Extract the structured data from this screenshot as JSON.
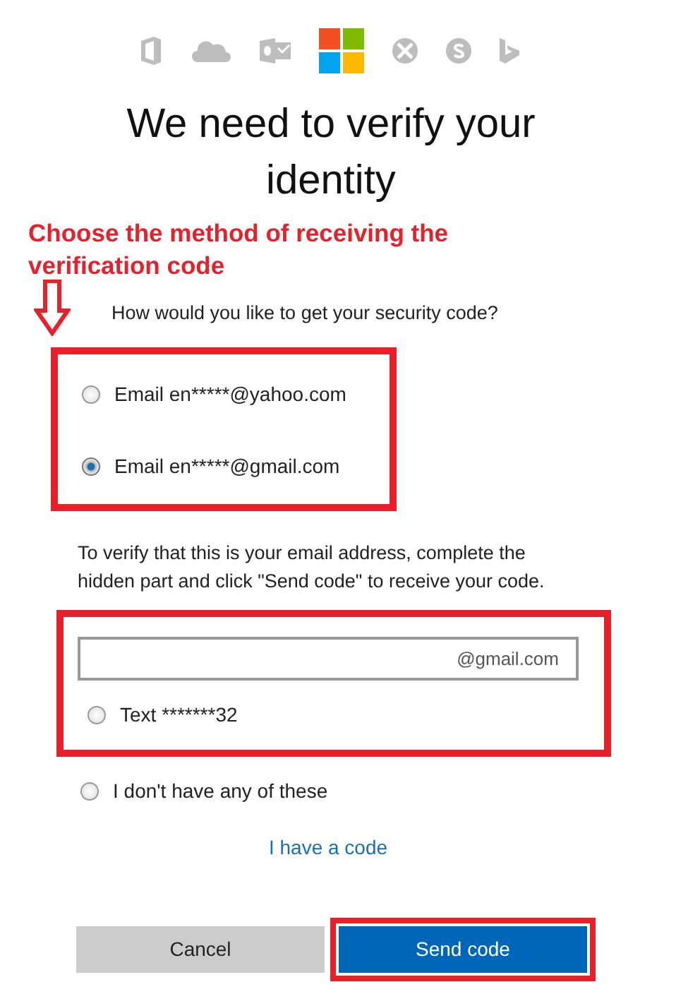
{
  "title": "We need to verify your identity",
  "annotation": {
    "text": "Choose the method of receiving the verification code"
  },
  "question": "How would you like to get your security code?",
  "options": [
    {
      "kind": "radio",
      "label": "Email en*****@yahoo.com",
      "selected": false,
      "framed": true
    },
    {
      "kind": "radio",
      "label": "Email en*****@gmail.com",
      "selected": true,
      "framed": true
    },
    {
      "kind": "hint",
      "text": "To verify that this is your email address, complete the hidden part and click \"Send code\" to receive your code."
    },
    {
      "kind": "field",
      "suffix": "@gmail.com",
      "framed": true
    },
    {
      "kind": "radio",
      "label": "Text *******32",
      "selected": false,
      "framed": true
    },
    {
      "kind": "radio",
      "label": "I don't have any of these",
      "selected": false,
      "framed": false
    }
  ],
  "link": "I have a code",
  "buttons": [
    {
      "label": "Cancel",
      "kind": "secondary",
      "framed": false
    },
    {
      "label": "Send code",
      "kind": "primary",
      "framed": true
    }
  ]
}
